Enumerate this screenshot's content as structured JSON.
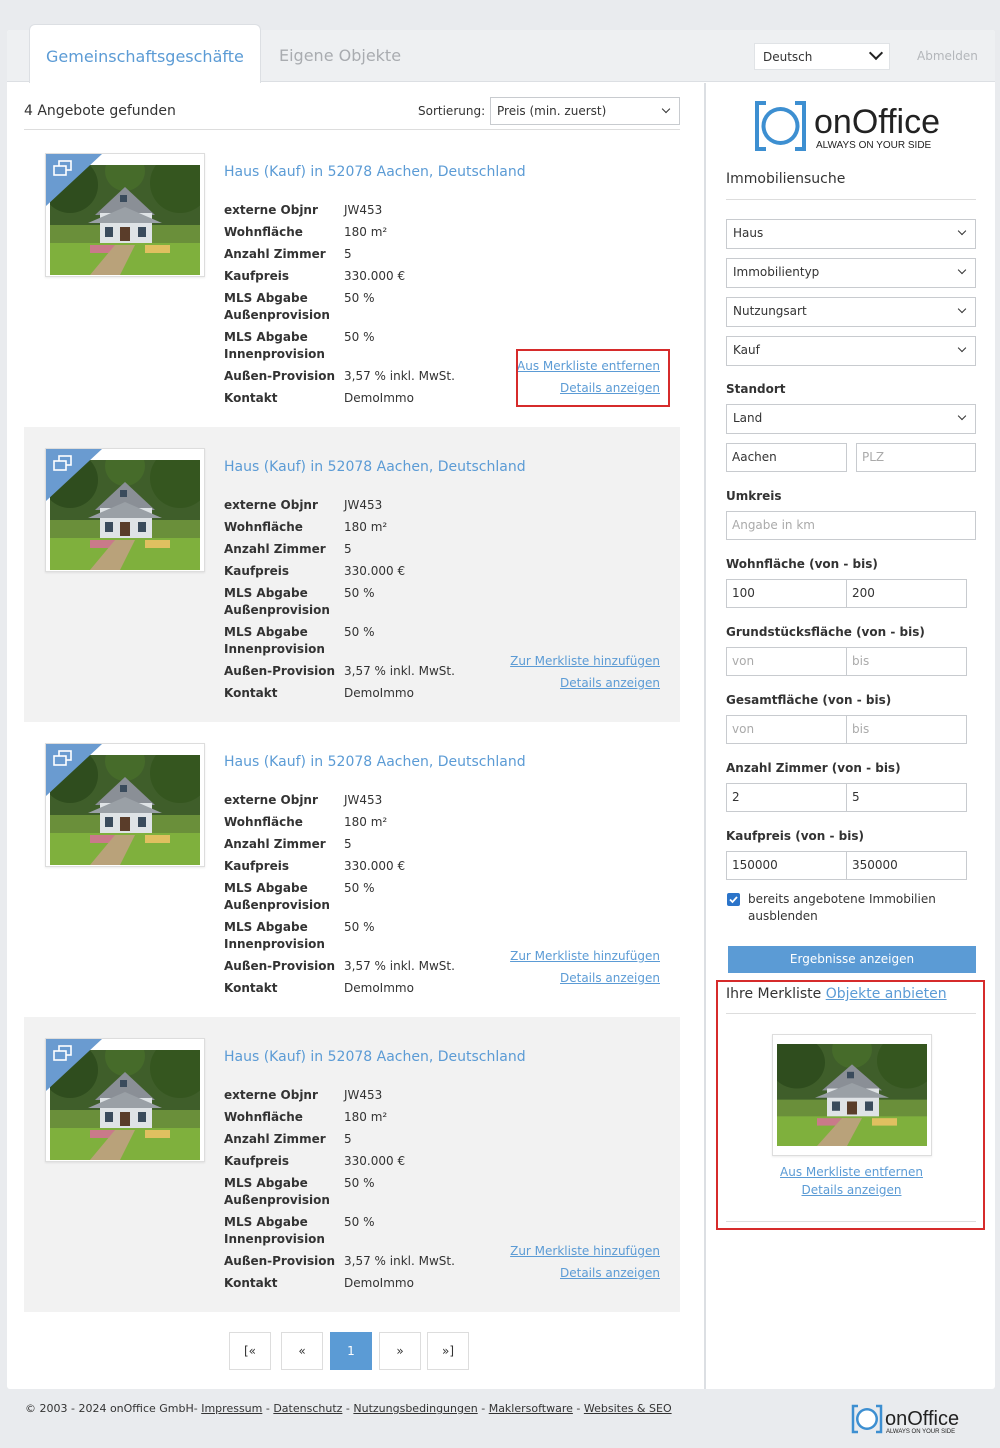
{
  "tabs": {
    "active": "Gemeinschaftsgeschäfte",
    "inactive": "Eigene Objekte"
  },
  "header": {
    "language": "Deutsch",
    "logout": "Abmelden"
  },
  "results": {
    "count_text": "4 Angebote gefunden",
    "sort_label": "Sortierung:",
    "sort_value": "Preis (min. zuerst)"
  },
  "listings": [
    {
      "title": "Haus (Kauf) in 52078 Aachen, Deutschland",
      "link1": "Aus Merkliste entfernen",
      "link2": "Details anzeigen"
    },
    {
      "title": "Haus (Kauf) in 52078 Aachen, Deutschland",
      "link1": "Zur Merkliste hinzufügen",
      "link2": "Details anzeigen"
    },
    {
      "title": "Haus (Kauf) in 52078 Aachen, Deutschland",
      "link1": "Zur Merkliste hinzufügen",
      "link2": "Details anzeigen"
    },
    {
      "title": "Haus (Kauf) in 52078 Aachen, Deutschland",
      "link1": "Zur Merkliste hinzufügen",
      "link2": "Details anzeigen"
    }
  ],
  "props": [
    {
      "k": "externe Objnr",
      "v": "JW453"
    },
    {
      "k": "Wohnfläche",
      "v": "180 m²"
    },
    {
      "k": "Anzahl Zimmer",
      "v": "5"
    },
    {
      "k": "Kaufpreis",
      "v": "330.000 €"
    },
    {
      "k": "MLS Abgabe Außenprovision",
      "v": "50 %"
    },
    {
      "k": "MLS Abgabe Innenprovision",
      "v": "50 %"
    },
    {
      "k": "Außen-Provision",
      "v": "3,57 % inkl. MwSt."
    },
    {
      "k": "Kontakt",
      "v": "DemoImmo"
    }
  ],
  "pagination": [
    "[«",
    "«",
    "1",
    "»",
    "»]"
  ],
  "brand": {
    "name": "onOffice",
    "tagline": "ALWAYS ON YOUR SIDE"
  },
  "search": {
    "heading": "Immobiliensuche",
    "objektart": "Haus",
    "immobilientyp": "Immobilientyp",
    "nutzungsart": "Nutzungsart",
    "vermarktungsart": "Kauf",
    "standort_label": "Standort",
    "land": "Land",
    "ort": "Aachen",
    "plz_placeholder": "PLZ",
    "umkreis_label": "Umkreis",
    "umkreis_placeholder": "Angabe in km",
    "wohnflaeche_label": "Wohnfläche (von - bis)",
    "wohnflaeche_von": "100",
    "wohnflaeche_bis": "200",
    "grundstueck_label": "Grundstücksfläche (von - bis)",
    "gesamt_label": "Gesamtfläche (von - bis)",
    "von_placeholder": "von",
    "bis_placeholder": "bis",
    "zimmer_label": "Anzahl Zimmer (von - bis)",
    "zimmer_von": "2",
    "zimmer_bis": "5",
    "kaufpreis_label": "Kaufpreis (von - bis)",
    "kaufpreis_von": "150000",
    "kaufpreis_bis": "350000",
    "checkbox_text": "bereits angebotene Immobilien ausblenden",
    "submit": "Ergebnisse anzeigen"
  },
  "merkliste": {
    "label": "Ihre Merkliste",
    "link": "Objekte anbieten",
    "remove": "Aus Merkliste entfernen",
    "details": "Details anzeigen"
  },
  "footer": {
    "copyright": "© 2003 - 2024 onOffice GmbH- ",
    "links": [
      "Impressum",
      "Datenschutz",
      "Nutzungsbedingungen",
      "Maklersoftware",
      "Websites & SEO"
    ],
    "sep": " - "
  },
  "colors": {
    "accent": "#5b9bd5",
    "highlight": "#d62b2b"
  }
}
